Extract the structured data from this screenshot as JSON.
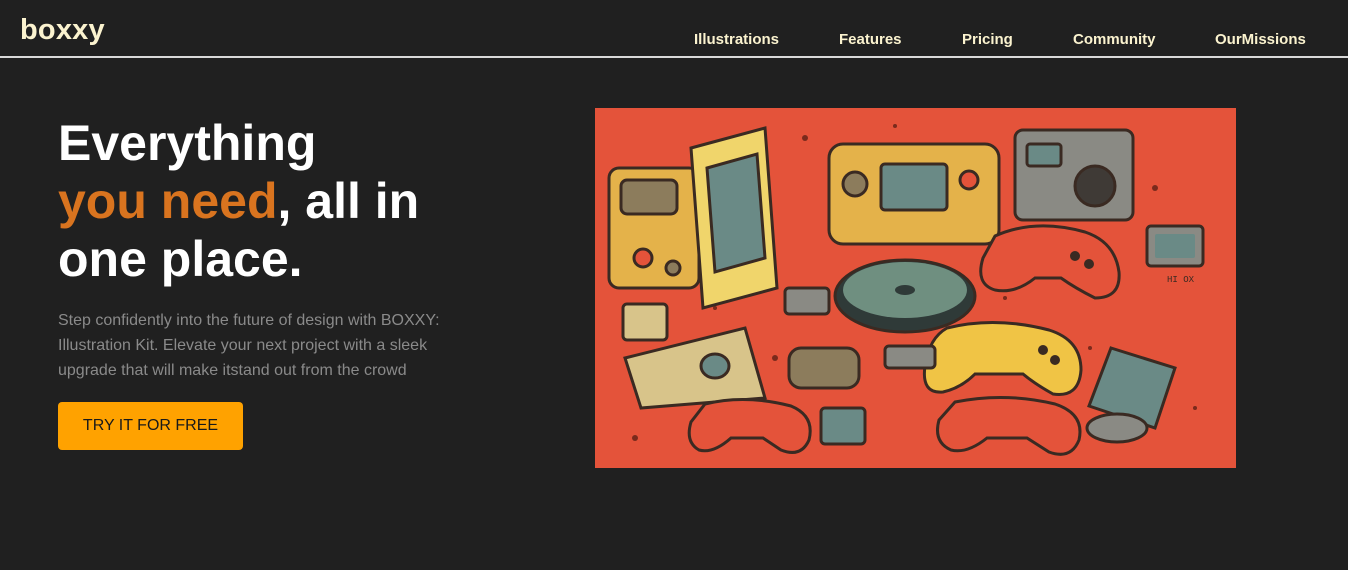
{
  "brand": {
    "logo": "boxxy"
  },
  "nav": {
    "items": [
      {
        "label": "Illustrations"
      },
      {
        "label": "Features"
      },
      {
        "label": "Pricing"
      },
      {
        "label": "Community"
      },
      {
        "label": "OurMissions"
      }
    ]
  },
  "hero": {
    "title_line1": "Everything",
    "title_accent": "you need",
    "title_rest_line2": ", all in",
    "title_line3": "one place.",
    "subtitle": "Step confidently into the future of design with BOXXY: Illustration Kit. Elevate your next project with a sleek upgrade that will make itstand out from the crowd",
    "cta_label": "TRY IT FOR FREE",
    "image": {
      "name": "retro-gaming-illustration",
      "screen_text": "HI OX"
    }
  },
  "colors": {
    "background": "#202020",
    "logo_and_nav": "#fbf3cf",
    "accent_text": "#d9741f",
    "cta_background": "#ffa200",
    "subtitle_text": "#8a8a8a",
    "illustration_background": "#e4533a"
  }
}
